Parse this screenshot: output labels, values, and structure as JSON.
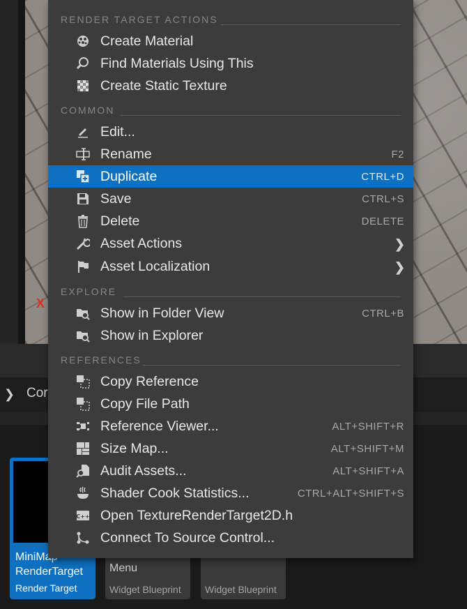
{
  "menu": {
    "sections": [
      {
        "label": "RENDER TARGET ACTIONS"
      },
      {
        "label": "COMMON"
      },
      {
        "label": "EXPLORE"
      },
      {
        "label": "REFERENCES"
      }
    ],
    "items": [
      {
        "label": "Create Material",
        "icon": "material-icon",
        "shortcut": ""
      },
      {
        "label": "Find Materials Using This",
        "icon": "magnifier-icon",
        "shortcut": ""
      },
      {
        "label": "Create Static Texture",
        "icon": "checker-texture-icon",
        "shortcut": ""
      },
      {
        "label": "Edit...",
        "icon": "pencil-icon",
        "shortcut": ""
      },
      {
        "label": "Rename",
        "icon": "rename-icon",
        "shortcut": "F2"
      },
      {
        "label": "Duplicate",
        "icon": "duplicate-icon",
        "shortcut": "CTRL+D"
      },
      {
        "label": "Save",
        "icon": "save-icon",
        "shortcut": "CTRL+S"
      },
      {
        "label": "Delete",
        "icon": "trash-icon",
        "shortcut": "DELETE"
      },
      {
        "label": "Asset Actions",
        "icon": "wrench-icon",
        "shortcut": "",
        "submenu": true
      },
      {
        "label": "Asset Localization",
        "icon": "flag-icon",
        "shortcut": "",
        "submenu": true
      },
      {
        "label": "Show in Folder View",
        "icon": "folder-search-icon",
        "shortcut": "CTRL+B"
      },
      {
        "label": "Show in Explorer",
        "icon": "folder-search-icon",
        "shortcut": ""
      },
      {
        "label": "Copy Reference",
        "icon": "copy-reference-icon",
        "shortcut": ""
      },
      {
        "label": "Copy File Path",
        "icon": "copy-path-icon",
        "shortcut": ""
      },
      {
        "label": "Reference Viewer...",
        "icon": "reference-viewer-icon",
        "shortcut": "ALT+SHIFT+R"
      },
      {
        "label": "Size Map...",
        "icon": "size-map-icon",
        "shortcut": "ALT+SHIFT+M"
      },
      {
        "label": "Audit Assets...",
        "icon": "audit-icon",
        "shortcut": "ALT+SHIFT+A"
      },
      {
        "label": "Shader Cook Statistics...",
        "icon": "shader-stats-icon",
        "shortcut": "CTRL+ALT+SHIFT+S"
      },
      {
        "label": "Open TextureRenderTarget2D.h",
        "icon": "cpp-file-icon",
        "shortcut": ""
      },
      {
        "label": "Connect To Source Control...",
        "icon": "source-control-icon",
        "shortcut": ""
      }
    ],
    "highlight_color": "#0e70c0"
  },
  "content_browser": {
    "path_label": "Cor",
    "tiles": [
      {
        "name": "MiniMap\nRenderTarget",
        "type": "Render Target",
        "selected": true
      },
      {
        "name": "Menu",
        "type": "Widget Blueprint"
      },
      {
        "name": "",
        "type": "Widget Blueprint"
      }
    ]
  },
  "viewport": {
    "axis_marker": "X"
  }
}
